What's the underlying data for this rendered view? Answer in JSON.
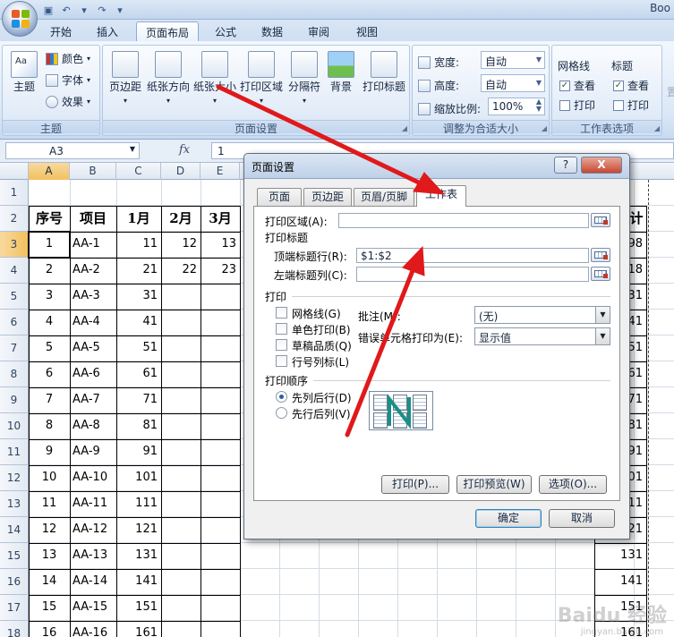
{
  "window": {
    "title": "Boo"
  },
  "tabs": [
    "开始",
    "插入",
    "页面布局",
    "公式",
    "数据",
    "审阅",
    "视图"
  ],
  "active_tab": "页面布局",
  "ribbon": {
    "theme": {
      "big": "主题",
      "colors": "颜色",
      "fonts": "字体",
      "effects": "效果",
      "label": "主题"
    },
    "page_setup": {
      "buttons": [
        "页边距",
        "纸张方向",
        "纸张大小",
        "打印区域",
        "分隔符",
        "背景",
        "打印标题"
      ],
      "label": "页面设置"
    },
    "scale": {
      "width_label": "宽度:",
      "width_value": "自动",
      "height_label": "高度:",
      "height_value": "自动",
      "scale_label": "缩放比例:",
      "scale_value": "100%",
      "label": "调整为合适大小"
    },
    "sheet_options": {
      "gridlines": "网格线",
      "headings": "标题",
      "view": "查看",
      "print": "打印",
      "label": "工作表选项"
    },
    "next_partial": "置"
  },
  "formula_bar": {
    "name_box": "A3",
    "fx": "fx",
    "value": "1"
  },
  "sheet": {
    "columns": [
      "A",
      "B",
      "C",
      "D",
      "E"
    ],
    "selected_column": "A",
    "rows": [
      "1",
      "2",
      "3",
      "4",
      "5",
      "6",
      "7",
      "8",
      "9",
      "10",
      "11",
      "12",
      "13",
      "14",
      "15",
      "16",
      "17",
      "18"
    ],
    "header_row": [
      "序号",
      "项目",
      "1月",
      "2月",
      "3月"
    ],
    "right_header": "计",
    "data": [
      {
        "n": "1",
        "item": "AA-1",
        "jan": "11",
        "feb": "12",
        "mar": "13",
        "tot": "98"
      },
      {
        "n": "2",
        "item": "AA-2",
        "jan": "21",
        "feb": "22",
        "mar": "23",
        "tot": "18"
      },
      {
        "n": "3",
        "item": "AA-3",
        "jan": "31",
        "feb": "",
        "mar": "",
        "tot": "31"
      },
      {
        "n": "4",
        "item": "AA-4",
        "jan": "41",
        "feb": "",
        "mar": "",
        "tot": "41"
      },
      {
        "n": "5",
        "item": "AA-5",
        "jan": "51",
        "feb": "",
        "mar": "",
        "tot": "51"
      },
      {
        "n": "6",
        "item": "AA-6",
        "jan": "61",
        "feb": "",
        "mar": "",
        "tot": "61"
      },
      {
        "n": "7",
        "item": "AA-7",
        "jan": "71",
        "feb": "",
        "mar": "",
        "tot": "71"
      },
      {
        "n": "8",
        "item": "AA-8",
        "jan": "81",
        "feb": "",
        "mar": "",
        "tot": "81"
      },
      {
        "n": "9",
        "item": "AA-9",
        "jan": "91",
        "feb": "",
        "mar": "",
        "tot": "91"
      },
      {
        "n": "10",
        "item": "AA-10",
        "jan": "101",
        "feb": "",
        "mar": "",
        "tot": "01"
      },
      {
        "n": "11",
        "item": "AA-11",
        "jan": "111",
        "feb": "",
        "mar": "",
        "tot": "11"
      },
      {
        "n": "12",
        "item": "AA-12",
        "jan": "121",
        "feb": "",
        "mar": "",
        "tot": "21"
      },
      {
        "n": "13",
        "item": "AA-13",
        "jan": "131",
        "feb": "",
        "mar": "",
        "tot": "131"
      },
      {
        "n": "14",
        "item": "AA-14",
        "jan": "141",
        "feb": "",
        "mar": "",
        "tot": "141"
      },
      {
        "n": "15",
        "item": "AA-15",
        "jan": "151",
        "feb": "",
        "mar": "",
        "tot": "151"
      },
      {
        "n": "16",
        "item": "AA-16",
        "jan": "161",
        "feb": "",
        "mar": "",
        "tot": "161"
      }
    ]
  },
  "dialog": {
    "title": "页面设置",
    "help": "?",
    "close": "X",
    "tabs": [
      "页面",
      "页边距",
      "页眉/页脚",
      "工作表"
    ],
    "active_tab": "工作表",
    "print_area_label": "打印区域(A):",
    "print_area_value": "",
    "print_titles_label": "打印标题",
    "top_rows_label": "顶端标题行(R):",
    "top_rows_value": "$1:$2",
    "left_cols_label": "左端标题列(C):",
    "left_cols_value": "",
    "print_label": "打印",
    "gridlines": "网格线(G)",
    "mono": "单色打印(B)",
    "draft": "草稿品质(Q)",
    "rowcol": "行号列标(L)",
    "comments_label": "批注(M):",
    "comments_value": "(无)",
    "errors_label": "错误单元格打印为(E):",
    "errors_value": "显示值",
    "order_label": "打印顺序",
    "down_then_over": "先列后行(D)",
    "over_then_down": "先行后列(V)",
    "btn_print": "打印(P)...",
    "btn_preview": "打印预览(W)",
    "btn_options": "选项(O)...",
    "btn_ok": "确定",
    "btn_cancel": "取消"
  },
  "watermark": {
    "main": "Baidu 经验",
    "sub": "jingyan.baidu.com"
  },
  "colors": {
    "accent_blue": "#c3d6ee",
    "arrow_red": "#e0191b",
    "selection": "#f1c15f"
  }
}
